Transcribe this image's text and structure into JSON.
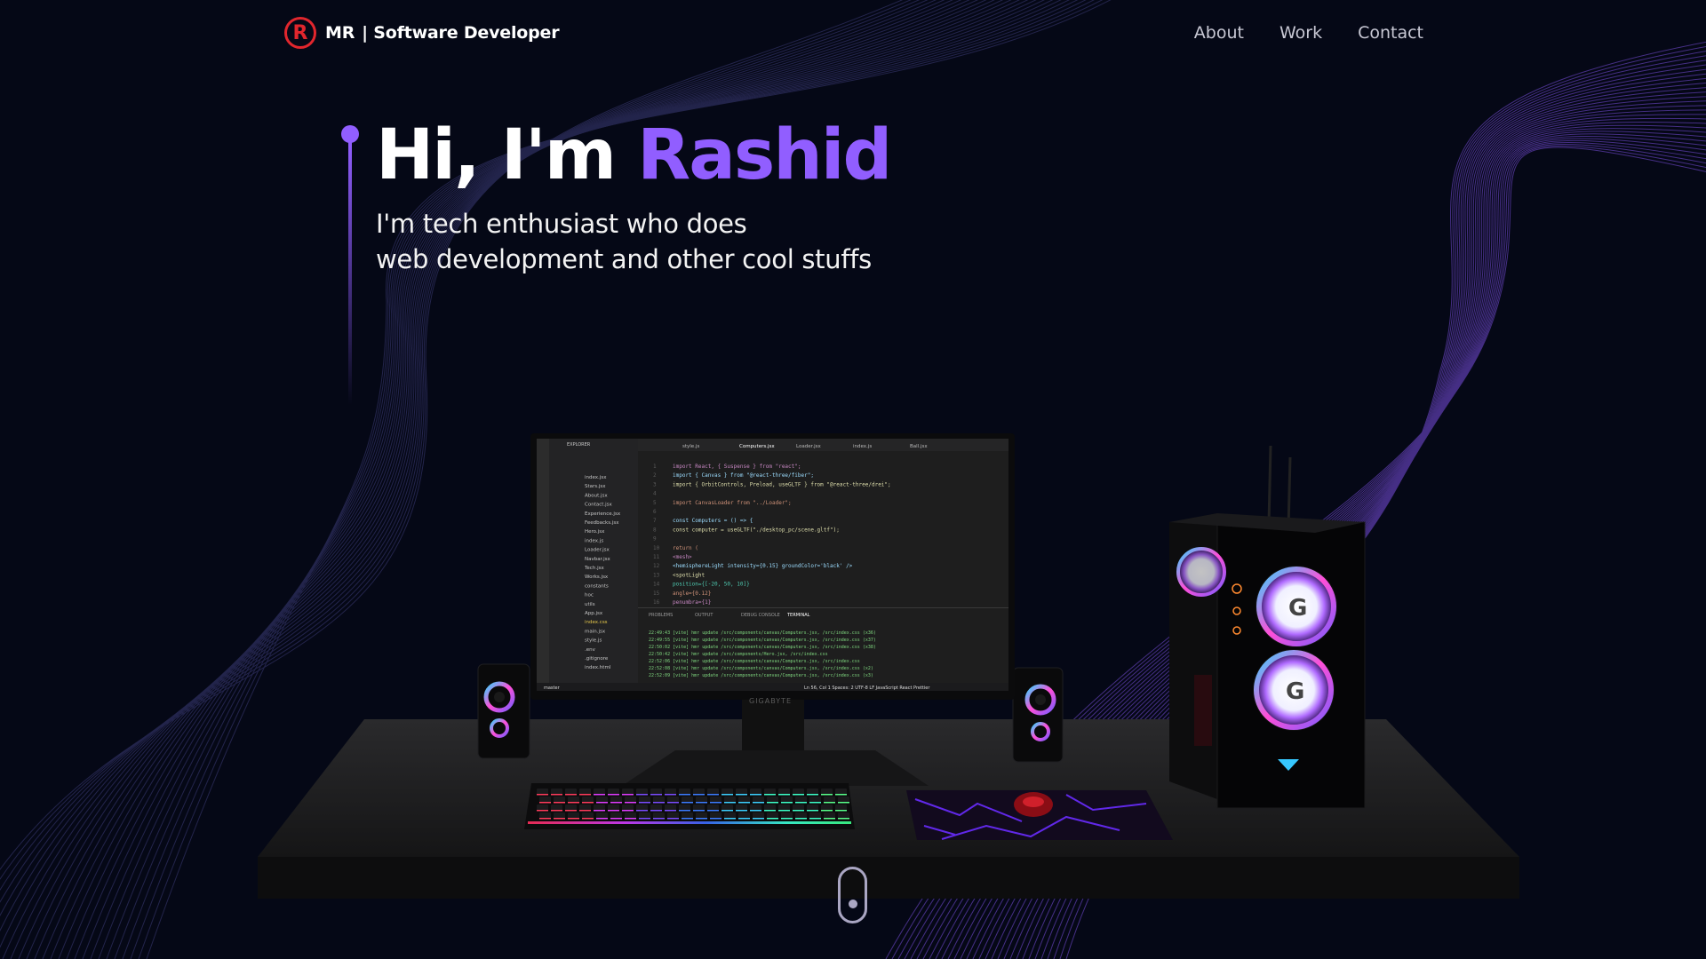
{
  "nav": {
    "logo_letter": "R",
    "brand_initials": "MR",
    "brand_title": "| Software Developer",
    "links": [
      {
        "label": "About"
      },
      {
        "label": "Work"
      },
      {
        "label": "Contact"
      }
    ]
  },
  "hero": {
    "greeting": "Hi, I'm",
    "name": "Rashid",
    "subtitle_line1": "I'm tech enthusiast who does",
    "subtitle_line2": "web development and other cool stuffs"
  },
  "colors": {
    "background": "#050816",
    "accent": "#915eff",
    "logo_red": "#e1262d",
    "nav_text": "#c8c8d4"
  },
  "scene": {
    "monitor_brand": "GIGABYTE",
    "editor_tabs": [
      "style.js",
      "Computers.jsx",
      "Loader.jsx",
      "index.js",
      "Ball.jsx"
    ],
    "panel_tabs": [
      "PROBLEMS",
      "OUTPUT",
      "DEBUG CONSOLE",
      "TERMINAL"
    ],
    "explorer_title": "EXPLORER",
    "explorer_files": [
      "index.jsx",
      "Stars.jsx",
      "About.jsx",
      "Contact.jsx",
      "Experience.jsx",
      "Feedbacks.jsx",
      "Hero.jsx",
      "index.js",
      "Loader.jsx",
      "Navbar.jsx",
      "Tech.jsx",
      "Works.jsx",
      "constants",
      "hoc",
      "utils",
      "App.jsx",
      "index.css",
      "main.jsx",
      "style.js",
      ".env",
      ".gitignore",
      "index.html"
    ],
    "code_lines": [
      "import React, { Suspense } from \"react\";",
      "import { Canvas } from \"@react-three/fiber\";",
      "import { OrbitControls, Preload, useGLTF } from \"@react-three/drei\";",
      "",
      "import CanvasLoader from \"../Loader\";",
      "",
      "const Computers = () => {",
      "  const computer = useGLTF(\"./desktop_pc/scene.gltf\");",
      "",
      "  return (",
      "    <mesh>",
      "      <hemisphereLight intensity={0.15} groundColor='black' />",
      "      <spotLight",
      "        position={[-20, 50, 10]}",
      "        angle={0.12}",
      "        penumbra={1}"
    ],
    "terminal_lines": [
      "22:49:43 [vite] hmr update /src/components/canvas/Computers.jsx, /src/index.css (x36)",
      "22:49:55 [vite] hmr update /src/components/canvas/Computers.jsx, /src/index.css (x37)",
      "22:50:02 [vite] hmr update /src/components/canvas/Computers.jsx, /src/index.css (x38)",
      "22:50:42 [vite] hmr update /src/components/Hero.jsx, /src/index.css",
      "22:52:06 [vite] hmr update /src/components/canvas/Computers.jsx, /src/index.css",
      "22:52:08 [vite] hmr update /src/components/canvas/Computers.jsx, /src/index.css (x2)",
      "22:52:09 [vite] hmr update /src/components/canvas/Computers.jsx, /src/index.css (x3)"
    ],
    "status_left": "master",
    "status_right": "Ln 56, Col 1   Spaces: 2   UTF-8   LF   JavaScript React   Prettier"
  }
}
